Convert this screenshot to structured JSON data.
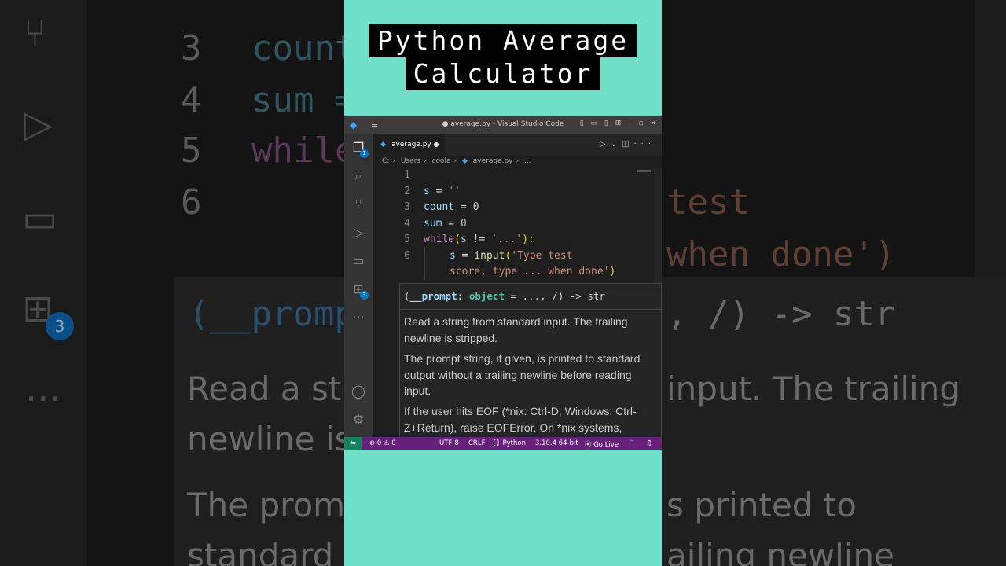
{
  "overlay_title": {
    "line1": "Python Average",
    "line2": "Calculator"
  },
  "window": {
    "title": "● average.py - Visual Studio Code",
    "logo_icon": "vscode-logo-icon",
    "menu_icon": "hamburger-menu-icon"
  },
  "tab": {
    "filename": "average.py",
    "language_icon": "python-file-icon",
    "modified": true
  },
  "breadcrumb": {
    "items": [
      "C:",
      "Users",
      "coola",
      "average.py",
      "..."
    ]
  },
  "editor": {
    "line_numbers": [
      "1",
      "2",
      "3",
      "4",
      "5",
      "6"
    ],
    "code": {
      "l2": {
        "var": "s",
        "op": " = ",
        "str": "''"
      },
      "l3": {
        "var": "count",
        "op": " = ",
        "num": "0"
      },
      "l4": {
        "var": "sum",
        "op": " = ",
        "num": "0"
      },
      "l5": {
        "kw": "while",
        "open": "(",
        "var": "s",
        "op": " != ",
        "str": "'...'",
        "close": "):"
      },
      "l6": {
        "var": "s",
        "op": " = ",
        "fn": "input",
        "open": "(",
        "str1": "'Type test",
        "str2": "score, type ... when done'",
        "close": ")"
      }
    }
  },
  "hover": {
    "signature": {
      "open": "(",
      "param": "__prompt",
      "colon": ": ",
      "type": "object",
      "rest": " = ..., /) -> str"
    },
    "paragraphs": [
      "Read a string from standard input. The trailing newline is stripped.",
      "The prompt string, if given, is printed to standard output without a trailing newline before reading input.",
      "If the user hits EOF (*nix: Ctrl-D, Windows: Ctrl-Z+Return), raise EOFError. On *nix systems,"
    ]
  },
  "statusbar": {
    "remote_icon": "remote-icon",
    "problems": "⊗ 0 ⚠ 0",
    "encoding": "UTF-8",
    "eol": "CRLF",
    "language": "{} Python",
    "interpreter": "3.10.4 64-bit",
    "golive": "Go Live",
    "accent_color": "#68217a",
    "remote_color": "#16825d"
  },
  "activity_bar": {
    "explorer_badge": "1",
    "extensions_badge": "3"
  },
  "background": {
    "line_numbers": [
      "3",
      "4",
      "5",
      "6"
    ],
    "code": [
      "count",
      "sum =",
      "while"
    ],
    "right_code": [
      "test",
      "when done')"
    ],
    "hover_sig": "(__prompt",
    "hover_sig_right": ", /) -> str",
    "para": [
      "Read a str",
      "newline is",
      "The promp",
      "standard"
    ],
    "para_right": [
      "input. The trailing",
      "s printed to",
      "ailing newline"
    ],
    "badge": "3"
  },
  "colors": {
    "panel_bg": "#70dfc8"
  }
}
